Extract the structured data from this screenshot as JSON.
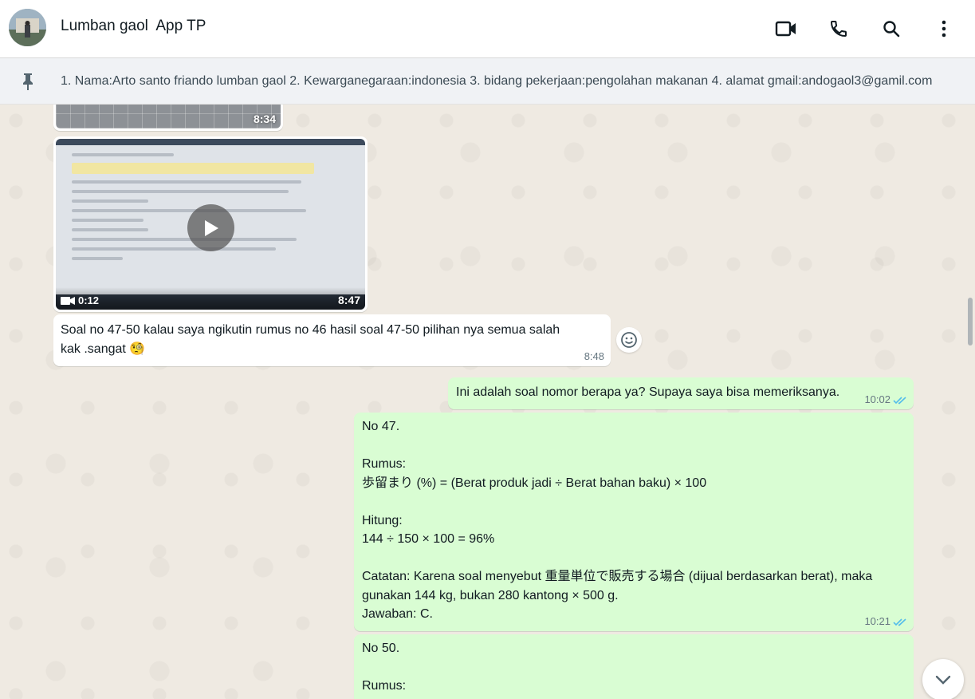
{
  "header": {
    "chat_name": "Lumban gaol  App TP",
    "icons": [
      "video-call-icon",
      "phone-icon",
      "search-icon",
      "more-vert-icon"
    ]
  },
  "pinned": {
    "text": "1. Nama:Arto santo friando lumban gaol 2. Kewarganegaraan:indonesia 3. bidang pekerjaan:pengolahan makanan 4. alamat gmail:andogaol3@gamil.com"
  },
  "messages": {
    "image1_time": "8:34",
    "video_time": "8:47",
    "video_duration": "0:12",
    "msg_in": {
      "text": "Soal no 47-50 kalau saya ngikutin rumus no 46 hasil soal 47-50 pilihan nya semua salah\nkak .sangat 🧐",
      "time": "8:48"
    },
    "msg_out1": {
      "text": "Ini adalah soal nomor berapa ya? Supaya saya bisa memeriksanya.",
      "time": "10:02"
    },
    "msg_out2": {
      "text": "No 47.\n\nRumus:\n歩留まり (%) = (Berat produk jadi ÷ Berat bahan baku) × 100\n\nHitung:\n144 ÷ 150 × 100 = 96%\n\nCatatan: Karena soal menyebut 重量単位で販売する場合 (dijual berdasarkan berat), maka\ngunakan 144 kg, bukan 280 kantong × 500 g.\nJawaban: C.",
      "time": "10:21"
    },
    "msg_out3": {
      "text": "No 50.\n\nRumus:"
    }
  },
  "colors": {
    "outgoing_bubble": "#d9fdd3",
    "incoming_bubble": "#ffffff",
    "read_tick": "#53bdeb",
    "chat_background": "#efeae2"
  }
}
